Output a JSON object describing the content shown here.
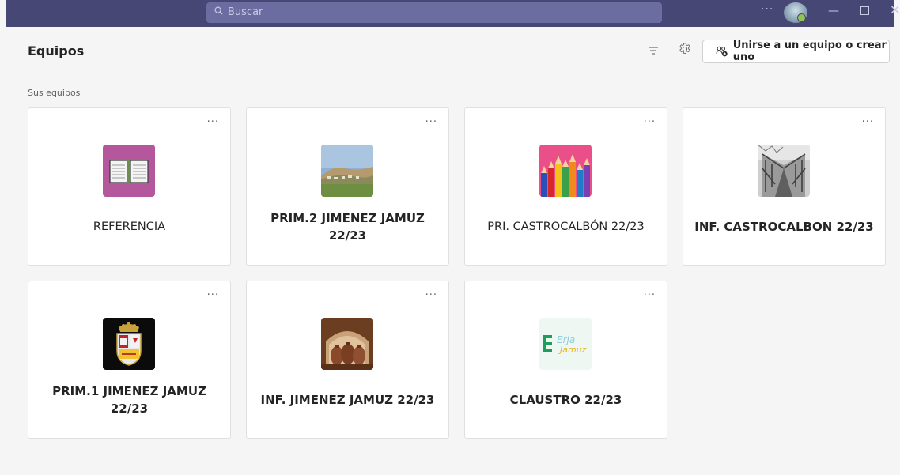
{
  "titlebar": {
    "search_placeholder": "Buscar",
    "more_label": "···",
    "minimize_label": "—",
    "close_label": "✕"
  },
  "header": {
    "title": "Equipos",
    "join_button_label": "Unirse a un equipo o crear uno"
  },
  "section": {
    "label": "Sus equipos"
  },
  "teams": [
    {
      "name": "REFERENCIA",
      "bold": false,
      "icon": "book-icon"
    },
    {
      "name": "PRIM.2 JIMENEZ JAMUZ 22/23",
      "bold": true,
      "icon": "landscape-photo"
    },
    {
      "name": "PRI. CASTROCALBÓN 22/23",
      "bold": false,
      "icon": "pencils-photo"
    },
    {
      "name": "INF. CASTROCALBON 22/23",
      "bold": true,
      "icon": "bridge-photo"
    },
    {
      "name": "PRIM.1 JIMENEZ JAMUZ 22/23",
      "bold": true,
      "icon": "coat-of-arms"
    },
    {
      "name": "INF. JIMENEZ JAMUZ 22/23",
      "bold": true,
      "icon": "pottery-photo"
    },
    {
      "name": "CLAUSTRO 22/23",
      "bold": true,
      "icon": "cra-logo"
    }
  ],
  "card_more_label": "···",
  "colors": {
    "titlebar": "#464775",
    "accent": "#6264a7",
    "background": "#f5f5f5"
  }
}
